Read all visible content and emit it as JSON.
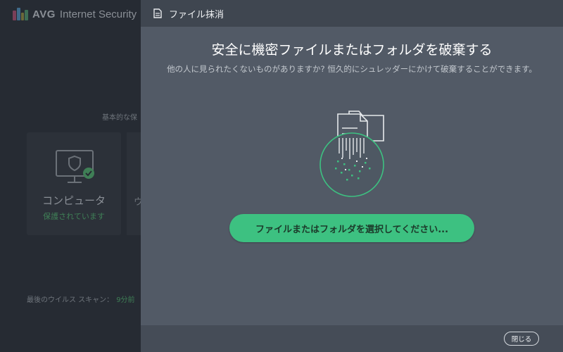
{
  "background_app": {
    "brand": "AVG",
    "product": "Internet Security",
    "section_title": "基本的な保",
    "tile": {
      "label": "コンピュータ",
      "status": "保護されています"
    },
    "tile2_fragment": "ウ",
    "last_scan_label": "最後のウイルス スキャン：",
    "last_scan_value": "9分前"
  },
  "dialog": {
    "title": "ファイル抹消",
    "heading": "安全に機密ファイルまたはフォルダを破棄する",
    "description": "他の人に見られたくないものがありますか? 恒久的にシュレッダーにかけて破棄することができます。",
    "select_button": "ファイルまたはフォルダを選択してください...",
    "close_button": "閉じる"
  },
  "colors": {
    "accent_green": "#3dc181",
    "dialog_bg": "#525a66",
    "header_bg": "#3f4650"
  },
  "icons": {
    "header": "document-icon",
    "illustration": "file-shredder-icon",
    "tile": "monitor-shield-check-icon"
  }
}
